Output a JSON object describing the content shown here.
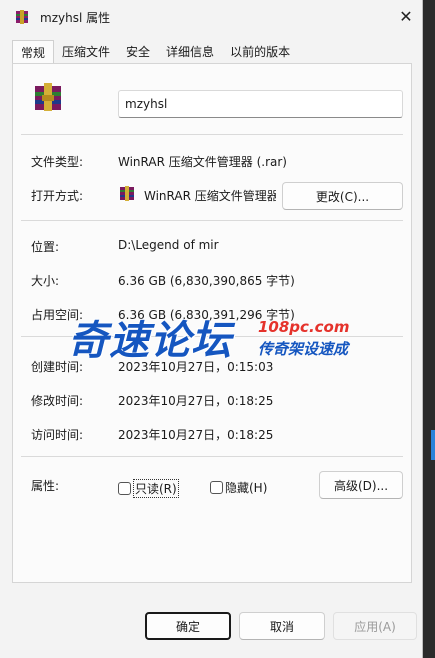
{
  "window": {
    "title": "mzyhsl 属性",
    "close_glyph": "✕"
  },
  "tabs": [
    {
      "label": "常规",
      "active": true
    },
    {
      "label": "压缩文件",
      "active": false
    },
    {
      "label": "安全",
      "active": false
    },
    {
      "label": "详细信息",
      "active": false
    },
    {
      "label": "以前的版本",
      "active": false
    }
  ],
  "general": {
    "file_name": "mzyhsl",
    "file_type_label": "文件类型:",
    "file_type_value": "WinRAR 压缩文件管理器 (.rar)",
    "open_with_label": "打开方式:",
    "open_with_value": "WinRAR 压缩文件管理器",
    "change_button": "更改(C)...",
    "location_label": "位置:",
    "location_value": "D:\\Legend of mir",
    "size_label": "大小:",
    "size_value": "6.36 GB (6,830,390,865 字节)",
    "size_on_disk_label": "占用空间:",
    "size_on_disk_value": "6.36 GB (6,830,391,296 字节)",
    "created_label": "创建时间:",
    "created_value": "2023年10月27日，0:15:03",
    "modified_label": "修改时间:",
    "modified_value": "2023年10月27日，0:18:25",
    "accessed_label": "访问时间:",
    "accessed_value": "2023年10月27日，0:18:25",
    "attributes_label": "属性:",
    "readonly_label": "只读(R)",
    "hidden_label": "隐藏(H)",
    "advanced_button": "高级(D)..."
  },
  "watermark": {
    "main": "奇速论坛",
    "url": "108pc.com",
    "sub": "传奇架设速成"
  },
  "footer": {
    "ok": "确定",
    "cancel": "取消",
    "apply": "应用(A)"
  },
  "colors": {
    "accent": "#1556c0",
    "watermark_red": "#e5322b"
  }
}
